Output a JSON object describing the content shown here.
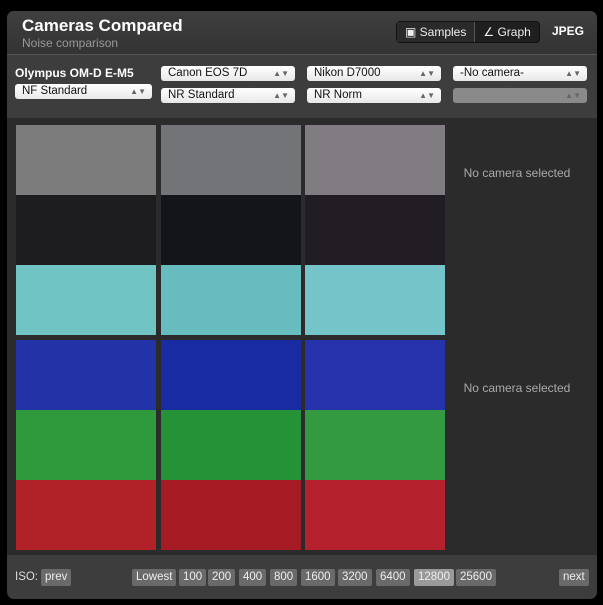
{
  "header": {
    "title": "Cameras Compared",
    "subtitle": "Noise comparison",
    "tabs": [
      {
        "label": "Samples",
        "icon": "samples-icon"
      },
      {
        "label": "Graph",
        "icon": "graph-icon"
      }
    ],
    "format": "JPEG"
  },
  "cameras": [
    {
      "name": "Olympus OM-D E-M5",
      "setting": "NF Standard"
    },
    {
      "name": "Canon EOS 7D",
      "setting": "NR Standard"
    },
    {
      "name": "Nikon D7000",
      "setting": "NR Norm"
    },
    {
      "name": "-No camera-",
      "setting": ""
    }
  ],
  "no_camera_text": "No camera selected",
  "swatch_colors": {
    "rows": [
      "#7c7c7c",
      "#1d1d1f",
      "#70c4c4",
      "#2233a8",
      "#2f9a3c",
      "#b02228"
    ]
  },
  "iso": {
    "label": "ISO:",
    "prev": "prev",
    "next": "next",
    "options": [
      "Lowest",
      "100",
      "200",
      "400",
      "800",
      "1600",
      "3200",
      "6400",
      "12800",
      "25600"
    ],
    "selected": "12800"
  }
}
